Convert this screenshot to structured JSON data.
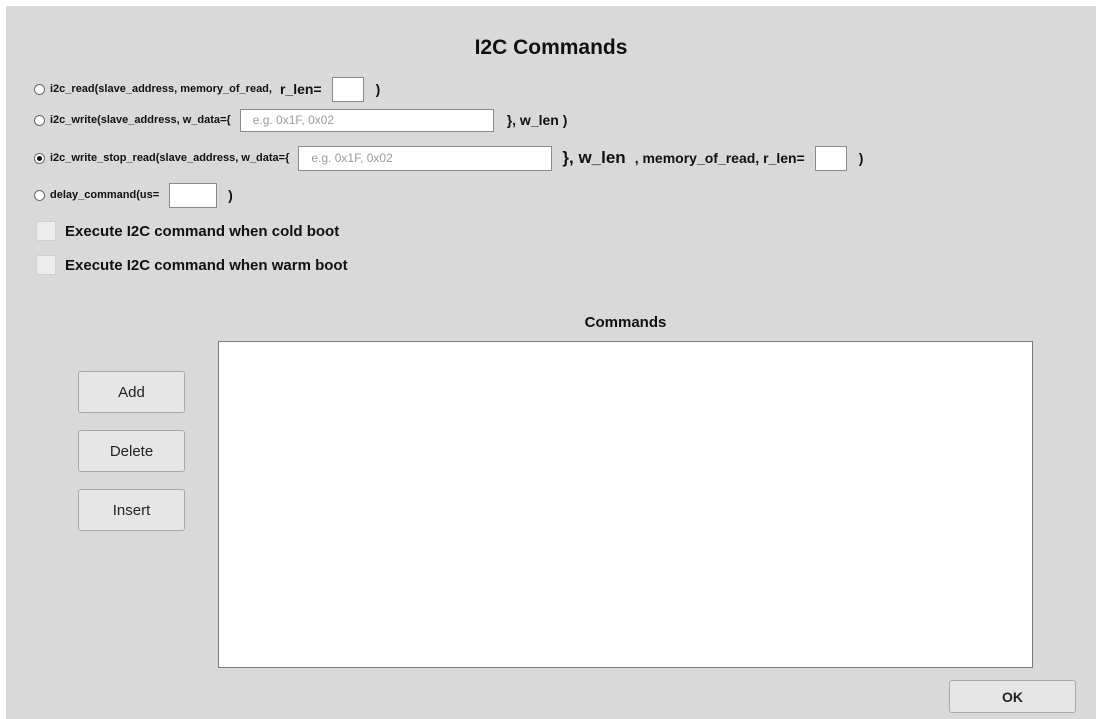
{
  "title": "I2C Commands",
  "options": {
    "read": {
      "label": "i2c_read(slave_address, memory_of_read,",
      "rlen_label": "r_len=",
      "close": ")",
      "selected": false
    },
    "write": {
      "label": "i2c_write(slave_address, w_data={",
      "wdata_placeholder": "e.g. 0x1F, 0x02",
      "wlen_label": "}, w_len )",
      "selected": false
    },
    "write_stop_read": {
      "label": "i2c_write_stop_read(slave_address, w_data={",
      "wdata_placeholder": "e.g. 0x1F, 0x02",
      "wlen_label": "}, w_len",
      "rest_label": ", memory_of_read, r_len=",
      "close": ")",
      "selected": true
    },
    "delay": {
      "label": "delay_command(us=",
      "close": ")",
      "selected": false
    }
  },
  "checkboxes": {
    "cold_boot": {
      "label": "Execute I2C command when cold boot",
      "checked": false
    },
    "warm_boot": {
      "label": "Execute I2C command when warm boot",
      "checked": false
    }
  },
  "commands": {
    "label": "Commands",
    "items": []
  },
  "buttons": {
    "add": "Add",
    "delete": "Delete",
    "insert": "Insert",
    "ok": "OK"
  }
}
